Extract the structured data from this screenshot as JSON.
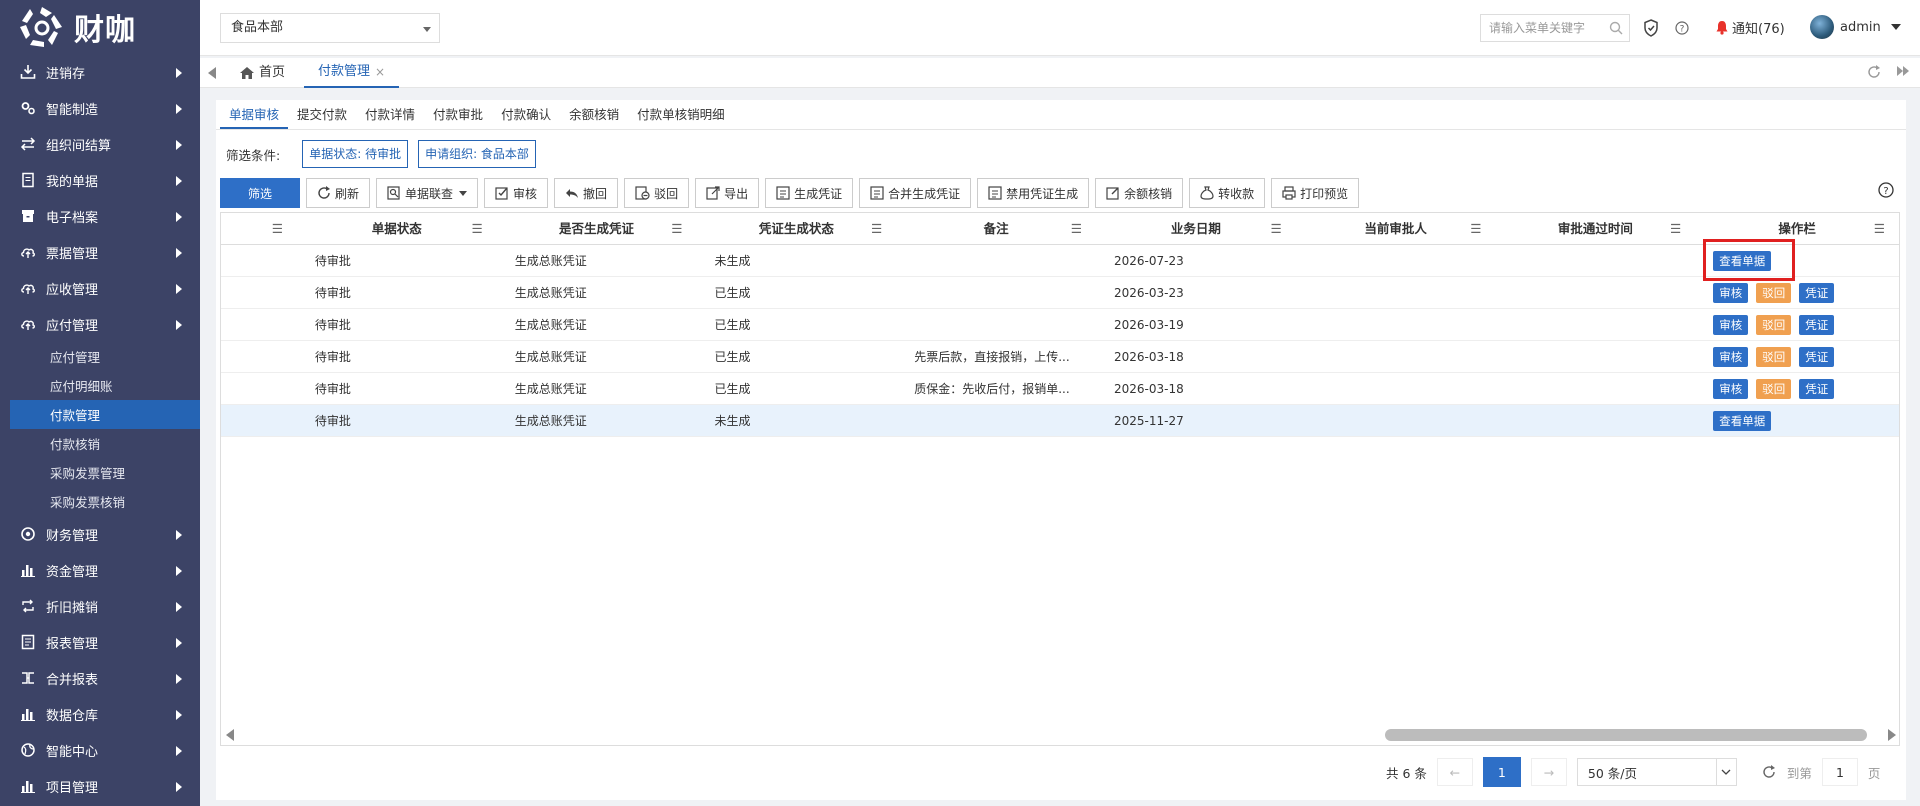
{
  "brand": {
    "logo_text": "财咖"
  },
  "sidebar": {
    "items": [
      {
        "label": "进销存",
        "icon": "import-icon"
      },
      {
        "label": "智能制造",
        "icon": "gears-icon"
      },
      {
        "label": "组织间结算",
        "icon": "exchange-icon"
      },
      {
        "label": "我的单据",
        "icon": "document-icon"
      },
      {
        "label": "电子档案",
        "icon": "archive-icon"
      },
      {
        "label": "票据管理",
        "icon": "cloud-upload-icon"
      },
      {
        "label": "应收管理",
        "icon": "cloud-upload-icon"
      },
      {
        "label": "应付管理",
        "icon": "cloud-upload-icon"
      }
    ],
    "sub_items": [
      {
        "label": "应付管理"
      },
      {
        "label": "应付明细账"
      },
      {
        "label": "付款管理",
        "active": true
      },
      {
        "label": "付款核销"
      },
      {
        "label": "采购发票管理"
      },
      {
        "label": "采购发票核销"
      }
    ],
    "items_after": [
      {
        "label": "财务管理",
        "icon": "circle-dot-icon"
      },
      {
        "label": "资金管理",
        "icon": "bar-chart-icon"
      },
      {
        "label": "折旧摊销",
        "icon": "repeat-icon"
      },
      {
        "label": "报表管理",
        "icon": "report-icon"
      },
      {
        "label": "合并报表",
        "icon": "merge-icon"
      },
      {
        "label": "数据仓库",
        "icon": "bar-chart-icon"
      },
      {
        "label": "智能中心",
        "icon": "globe-icon"
      },
      {
        "label": "项目管理",
        "icon": "bar-chart-icon"
      }
    ]
  },
  "topbar": {
    "org": "食品本部",
    "search_placeholder": "请输入菜单关键字",
    "notice": "通知(76)",
    "user": "admin"
  },
  "tabs": {
    "home": "首页",
    "current": "付款管理",
    "close": "×"
  },
  "subtabs": [
    "单据审核",
    "提交付款",
    "付款详情",
    "付款审批",
    "付款确认",
    "余额核销",
    "付款单核销明细"
  ],
  "filter": {
    "label": "筛选条件:",
    "chips": [
      "单据状态: 待审批",
      "申请组织: 食品本部"
    ]
  },
  "toolbar": {
    "filter": "筛选",
    "refresh": "刷新",
    "query": "单据联查",
    "audit": "审核",
    "revoke": "撤回",
    "reject": "驳回",
    "export": "导出",
    "gen_voucher": "生成凭证",
    "merge_voucher": "合并生成凭证",
    "disable_voucher": "禁用凭证生成",
    "balance": "余额核销",
    "transfer": "转收款",
    "print": "打印预览"
  },
  "table": {
    "columns": [
      "单据状态",
      "是否生成凭证",
      "凭证生成状态",
      "备注",
      "业务日期",
      "当前审批人",
      "审批通过时间",
      "操作栏"
    ],
    "rows": [
      {
        "status": "待审批",
        "voucher": "生成总账凭证",
        "gen_status": "未生成",
        "note": "",
        "date": "2026-07-23",
        "approver": "",
        "approve_time": "",
        "ops": [
          "查看单据"
        ]
      },
      {
        "status": "待审批",
        "voucher": "生成总账凭证",
        "gen_status": "已生成",
        "note": "",
        "date": "2026-03-23",
        "approver": "",
        "approve_time": "",
        "ops": [
          "审核",
          "驳回",
          "凭证"
        ]
      },
      {
        "status": "待审批",
        "voucher": "生成总账凭证",
        "gen_status": "已生成",
        "note": "",
        "date": "2026-03-19",
        "approver": "",
        "approve_time": "",
        "ops": [
          "审核",
          "驳回",
          "凭证"
        ]
      },
      {
        "status": "待审批",
        "voucher": "生成总账凭证",
        "gen_status": "已生成",
        "note": "先票后款，直接报销，上传...",
        "date": "2026-03-18",
        "approver": "",
        "approve_time": "",
        "ops": [
          "审核",
          "驳回",
          "凭证"
        ]
      },
      {
        "status": "待审批",
        "voucher": "生成总账凭证",
        "gen_status": "已生成",
        "note": "质保金：先收后付，报销单...",
        "date": "2026-03-18",
        "approver": "",
        "approve_time": "",
        "ops": [
          "审核",
          "驳回",
          "凭证"
        ]
      },
      {
        "status": "待审批",
        "voucher": "生成总账凭证",
        "gen_status": "未生成",
        "note": "",
        "date": "2025-11-27",
        "approver": "",
        "approve_time": "",
        "ops": [
          "查看单据"
        ]
      }
    ]
  },
  "pager": {
    "total": "共 6 条",
    "prev": "←",
    "next": "→",
    "page": "1",
    "size": "50 条/页",
    "goto": "到第",
    "goto_page": "1",
    "page_unit": "页"
  },
  "colors": {
    "sidebar": "#3c4366",
    "primary": "#2e6fc7",
    "reject": "#f0a050",
    "highlight": "#e02020"
  }
}
